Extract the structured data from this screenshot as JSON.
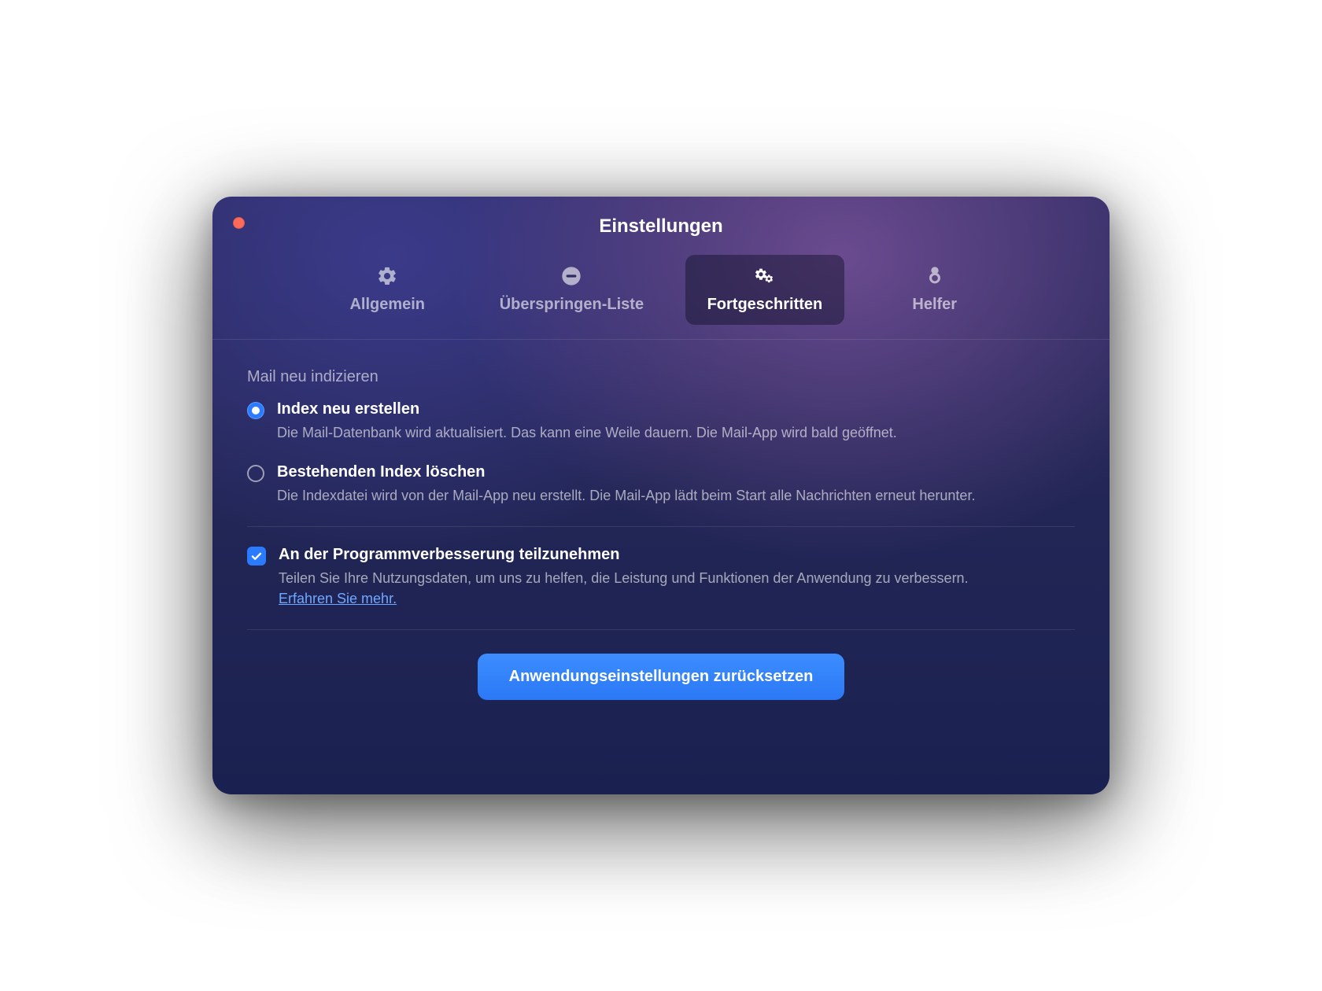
{
  "window": {
    "title": "Einstellungen"
  },
  "tabs": {
    "general": "Allgemein",
    "skiplist": "Überspringen-Liste",
    "advanced": "Fortgeschritten",
    "helper": "Helfer"
  },
  "section": {
    "heading": "Mail neu indizieren",
    "rebuild": {
      "title": "Index neu erstellen",
      "desc": "Die Mail-Datenbank wird aktualisiert. Das kann eine Weile dauern. Die Mail-App wird bald geöffnet."
    },
    "delete": {
      "title": "Bestehenden Index löschen",
      "desc": "Die Indexdatei wird von der Mail-App neu erstellt. Die Mail-App lädt beim Start alle Nachrichten erneut herunter."
    }
  },
  "improve": {
    "title": "An der Programmverbesserung teilzunehmen",
    "desc": "Teilen Sie Ihre Nutzungsdaten, um uns zu helfen, die Leistung und Funktionen der Anwendung zu verbessern.",
    "learn_more": "Erfahren Sie mehr."
  },
  "reset_button": "Anwendungseinstellungen zurücksetzen"
}
